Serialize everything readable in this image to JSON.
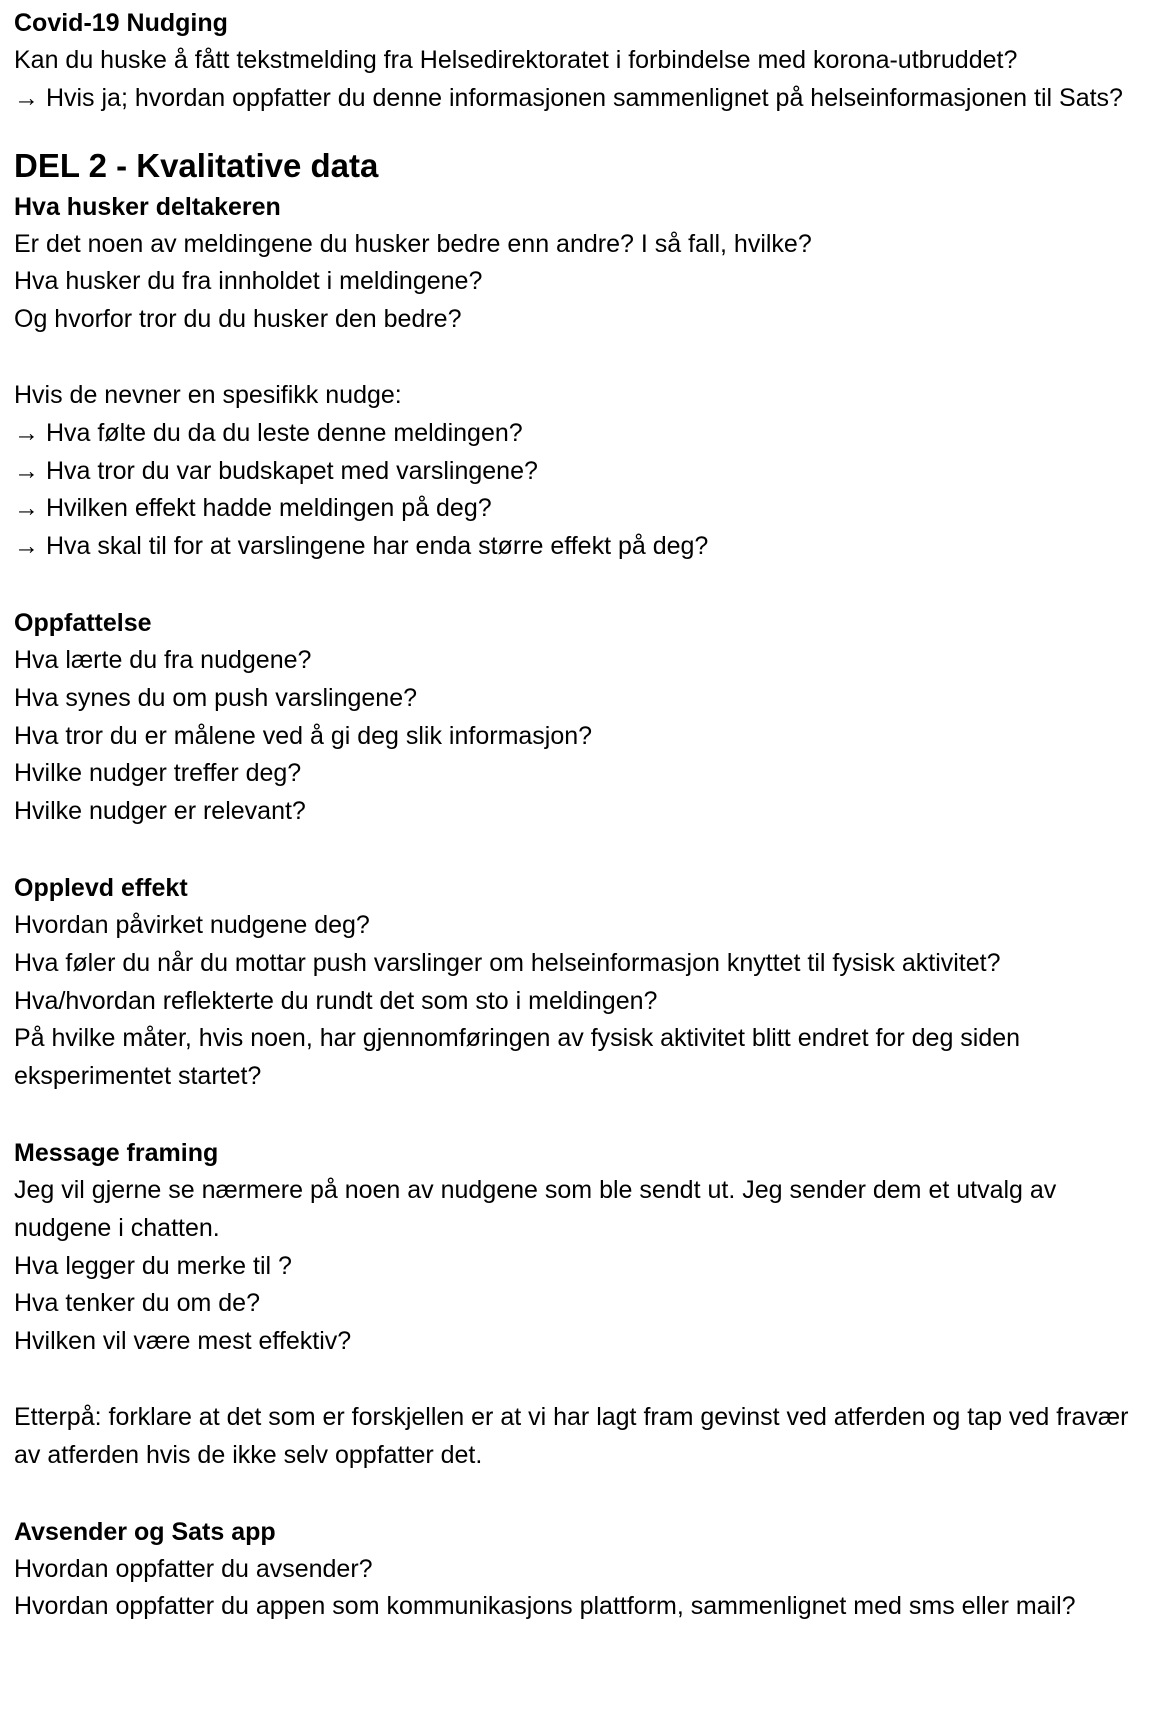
{
  "section_covid": {
    "heading": "Covid-19 Nudging",
    "lines": [
      "Kan du huske å fått tekstmelding fra Helsedirektoratet i forbindelse med korona-utbruddet?",
      "→ Hvis ja; hvordan oppfatter du denne informasjonen sammenlignet på helseinformasjonen til Sats?"
    ]
  },
  "part2": {
    "title": "DEL 2 - Kvalitative data"
  },
  "section_remember": {
    "heading": "Hva husker deltakeren",
    "lines": [
      "Er det noen av meldingene du husker bedre enn andre? I så fall, hvilke?",
      "Hva husker du fra innholdet i meldingene?",
      "Og hvorfor tror du du husker den bedre?"
    ],
    "followup_intro": "Hvis de nevner en spesifikk nudge:",
    "followups": [
      "→ Hva følte du da du leste denne meldingen?",
      "→ Hva tror du var budskapet med varslingene?",
      "→ Hvilken effekt hadde meldingen på deg?",
      "→ Hva skal til for at varslingene har enda større effekt på deg?"
    ]
  },
  "section_perception": {
    "heading": "Oppfattelse",
    "lines": [
      "Hva lærte du fra nudgene?",
      "Hva synes du om push varslingene?",
      "Hva tror du er målene ved å gi deg slik informasjon?",
      "Hvilke nudger treffer deg?",
      "Hvilke nudger er relevant?"
    ]
  },
  "section_effect": {
    "heading": "Opplevd effekt",
    "lines": [
      "Hvordan påvirket nudgene deg?",
      "Hva føler du når du mottar push varslinger om helseinformasjon knyttet til fysisk aktivitet?",
      "Hva/hvordan reflekterte du rundt det som sto i meldingen?",
      "På hvilke måter, hvis noen, har gjennomføringen av fysisk aktivitet blitt endret for deg siden eksperimentet startet?"
    ]
  },
  "section_framing": {
    "heading": "Message framing",
    "lines": [
      "Jeg vil gjerne se nærmere på noen av nudgene som ble sendt ut. Jeg sender dem et utvalg av nudgene i chatten.",
      "Hva legger du merke til ?",
      "Hva tenker du om de?",
      "Hvilken vil være mest effektiv?"
    ],
    "afterword": "Etterpå: forklare at det som er forskjellen er at vi har lagt fram gevinst ved atferden og tap ved fravær av atferden hvis de ikke selv oppfatter det."
  },
  "section_sender": {
    "heading": "Avsender og Sats app",
    "lines": [
      "Hvordan oppfatter du avsender?",
      "Hvordan oppfatter du appen som kommunikasjons plattform, sammenlignet med sms eller mail?"
    ]
  }
}
